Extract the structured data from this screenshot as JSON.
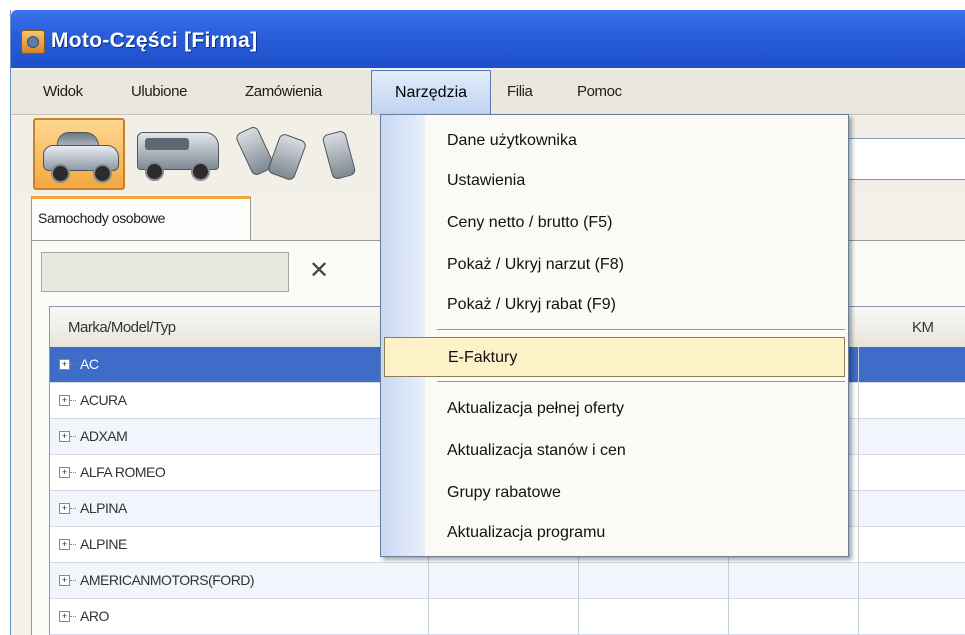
{
  "window": {
    "title": "Moto-Części  [Firma]"
  },
  "menubar": {
    "items": [
      {
        "label": "Widok"
      },
      {
        "label": "Ulubione"
      },
      {
        "label": "Zamówienia"
      },
      {
        "label": "Narzędzia"
      },
      {
        "label": "Filia"
      },
      {
        "label": "Pomoc"
      }
    ]
  },
  "toolbar": {
    "buttons": [
      {
        "icon": "passenger-car-icon",
        "selected": true
      },
      {
        "icon": "delivery-van-icon",
        "selected": false
      },
      {
        "icon": "engine-parts-icon",
        "selected": false
      },
      {
        "icon": "parts-icon",
        "selected": false
      }
    ]
  },
  "tabs": [
    {
      "label": "Samochody osobowe"
    }
  ],
  "filter": {
    "value": "",
    "clear_icon": "✕"
  },
  "grid": {
    "columns": [
      "Marka/Model/Typ",
      "",
      "",
      "",
      "",
      "KM"
    ],
    "rows": [
      {
        "label": "AC",
        "selected": true
      },
      {
        "label": "ACURA"
      },
      {
        "label": "ADXAM"
      },
      {
        "label": "ALFA ROMEO"
      },
      {
        "label": "ALPINA"
      },
      {
        "label": "ALPINE"
      },
      {
        "label": "AMERICANMOTORS(FORD)"
      },
      {
        "label": "ARO"
      }
    ]
  },
  "dropdown": {
    "menu": "Narzędzia",
    "items": [
      {
        "label": "Dane użytkownika"
      },
      {
        "label": "Ustawienia"
      },
      {
        "label": "Ceny netto / brutto (F5)"
      },
      {
        "label": "Pokaż / Ukryj narzut (F8)"
      },
      {
        "label": "Pokaż / Ukryj rabat (F9)"
      },
      {
        "label": "E-Faktury",
        "highlighted": true
      },
      {
        "label": "Aktualizacja pełnej oferty"
      },
      {
        "label": "Aktualizacja stanów i cen"
      },
      {
        "label": "Grupy rabatowe"
      },
      {
        "label": "Aktualizacja programu"
      }
    ]
  },
  "colors": {
    "titlebar": "#2a5fdb",
    "selected_row": "#3f6cc9",
    "menu_highlight": "#fdf1c8",
    "tab_accent": "#f0a63b"
  }
}
